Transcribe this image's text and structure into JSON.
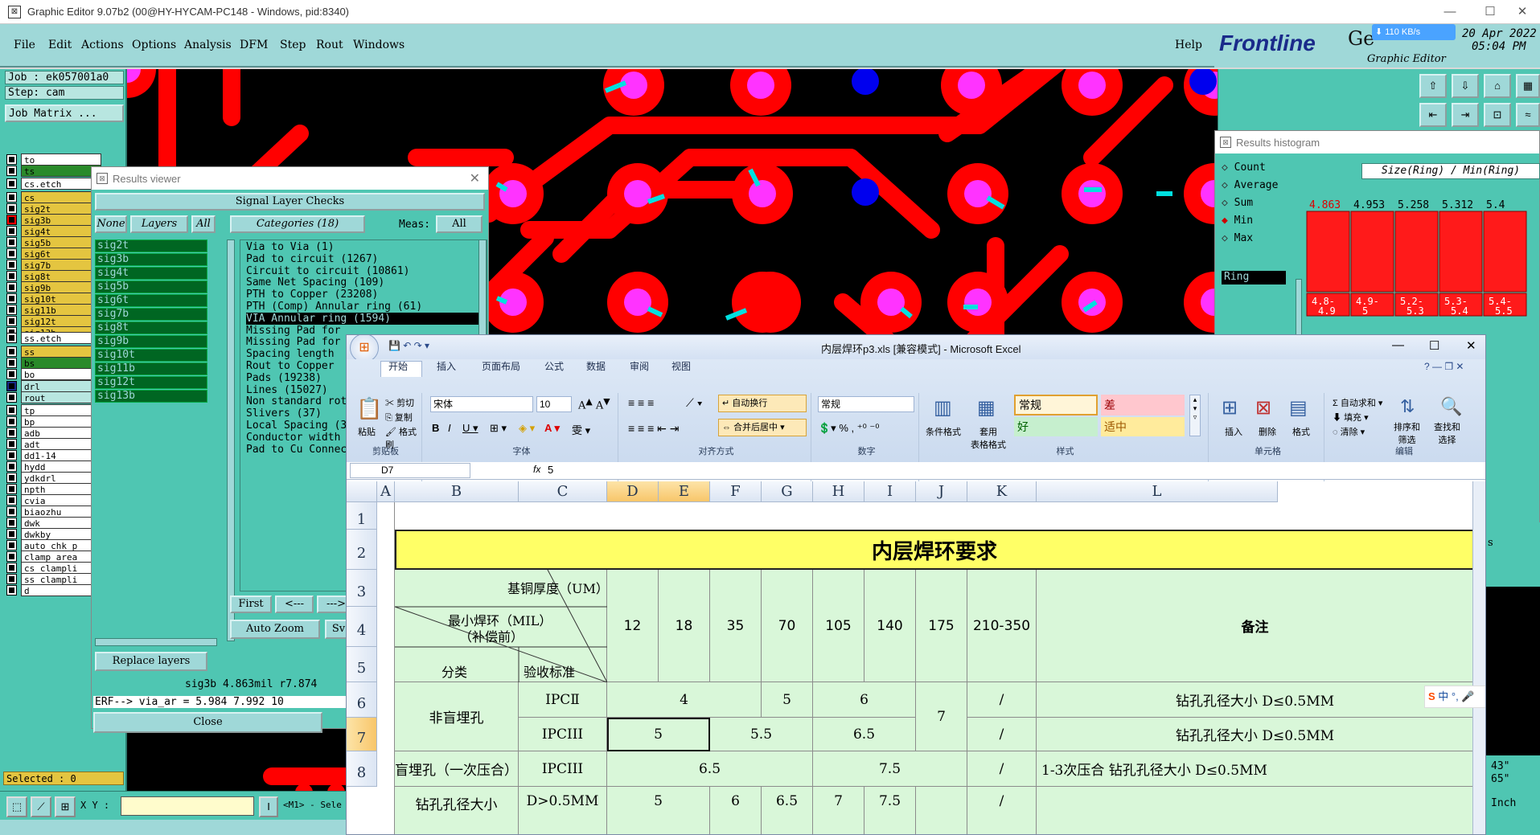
{
  "genesis": {
    "window_title": "Graphic Editor 9.07b2 (00@HY-HYCAM-PC148 - Windows, pid:8340)",
    "menu": [
      "File",
      "Edit",
      "Actions",
      "Options",
      "Analysis",
      "DFM",
      "Step",
      "Rout",
      "Windows"
    ],
    "help": "Help",
    "brand": "Frontline",
    "brand_product": "Ge",
    "brand_sub": "Graphic Editor",
    "date": "20 Apr 2022",
    "time": "05:04 PM",
    "net_speed": "110 KB/s",
    "job_label": "Job : ek057001a0",
    "step_label": "Step: cam",
    "job_matrix": "Job Matrix ...",
    "layers": [
      "to",
      "ts",
      "cs.etch",
      "cs",
      "sig2t",
      "sig3b",
      "sig4t",
      "sig5b",
      "sig6t",
      "sig7b",
      "sig8t",
      "sig9b",
      "sig10t",
      "sig11b",
      "sig12t",
      "sig13b",
      "ss.etch",
      "ss",
      "bs",
      "bo",
      "drl",
      "rout",
      "tp",
      "bp",
      "adb",
      "adt",
      "dd1-14",
      "hydd",
      "ydkdrl",
      "npth",
      "cvia",
      "biaozhu",
      "dwk",
      "dwkby",
      "auto_chk_p",
      "clamp_area",
      "cs_clampli",
      "ss_clampli",
      "d"
    ],
    "selected": "Selected : 0",
    "xy_label": "X Y :",
    "m1_label": "<M1> - Sele"
  },
  "results_viewer": {
    "title": "Results viewer",
    "header": "Signal Layer Checks",
    "btn_none": "None",
    "btn_layers": "Layers",
    "btn_all": "All",
    "categories_label": "Categories (18)",
    "meas_label": "Meas:",
    "meas_value": "All",
    "signal_layers": [
      "sig2t",
      "sig3b",
      "sig4t",
      "sig5b",
      "sig6t",
      "sig7b",
      "sig8t",
      "sig9b",
      "sig10t",
      "sig11b",
      "sig12t",
      "sig13b"
    ],
    "categories": [
      "Via to Via (1)",
      "Pad to circuit (1267)",
      "Circuit to circuit (10861)",
      "Same Net Spacing (109)",
      "PTH to Copper (23208)",
      "PTH (Comp) Annular ring (61)",
      "VIA Annular ring (1594)",
      "Missing Pad for",
      "Missing Pad for",
      "Spacing length",
      "Rout to Copper",
      "Pads (19238)",
      "Lines (15027)",
      "Non standard rot",
      "Slivers (37)",
      "Local Spacing (3",
      "Conductor width",
      "Pad to Cu Connec"
    ],
    "btn_first": "First",
    "btn_prev": "<---",
    "btn_next": "--->",
    "auto_zoom": "Auto Zoom",
    "sv": "Sv",
    "replace_layers": "Replace layers",
    "status1": "sig3b 4.863mil  r7.874",
    "status2": "ERF--> via_ar = 5.984 7.992 10",
    "close": "Close"
  },
  "histogram": {
    "title": "Results histogram",
    "options": [
      "Count",
      "Average",
      "Sum",
      "Min",
      "Max"
    ],
    "selected_option": "Min",
    "field": "Ring",
    "chart_title": "Size(Ring) / Min(Ring)",
    "top_labels": [
      "4.863",
      "4.953",
      "5.258",
      "5.312",
      "5.4"
    ],
    "bottom_labels": [
      "4.8-\n4.9",
      "4.9-\n5",
      "5.2-\n5.3",
      "5.3-\n5.4",
      "5.4-\n5.5"
    ],
    "fragment": "ion",
    "side_frag": "s",
    "frag_43": "43\"",
    "frag_65": "65\"",
    "inch": "Inch"
  },
  "excel": {
    "title": "内层焊环p3.xls  [兼容模式] - Microsoft Excel",
    "tabs": [
      "开始",
      "插入",
      "页面布局",
      "公式",
      "数据",
      "审阅",
      "视图"
    ],
    "groups": {
      "clipboard": "剪贴板",
      "paste": "粘贴",
      "cut": "剪切",
      "copy": "复制",
      "format_painter": "格式刷",
      "font": "字体",
      "font_name": "宋体",
      "font_size": "10",
      "align": "对齐方式",
      "wrap": "自动换行",
      "merge": "合并后居中",
      "number": "数字",
      "number_format": "常规",
      "styles": "样式",
      "cond_format": "条件格式",
      "table_format": "套用\n表格格式",
      "style_normal": "常规",
      "style_bad": "差",
      "style_good": "好",
      "style_neutral": "适中",
      "cells": "单元格",
      "insert": "插入",
      "delete": "删除",
      "format": "格式",
      "edit": "编辑",
      "autosum": "自动求和",
      "fill": "填充",
      "clear": "清除",
      "sort": "排序和\n筛选",
      "find": "查找和\n选择"
    },
    "name_box": "D7",
    "formula": "5",
    "columns": [
      "A",
      "B",
      "C",
      "D",
      "E",
      "F",
      "G",
      "H",
      "I",
      "J",
      "K",
      "L"
    ],
    "rows": [
      "1",
      "2",
      "3",
      "4",
      "5",
      "6",
      "7",
      "8"
    ],
    "sheet": {
      "title": "内层焊环要求",
      "hdr_thickness": "基铜厚度（UM）",
      "hdr_min_ring": "最小焊环（MIL）",
      "hdr_min_ring2": "（补偿前）",
      "hdr_category": "分类",
      "hdr_standard": "验收标准",
      "thickness": [
        "12",
        "18",
        "35",
        "70",
        "105",
        "140",
        "175",
        "210-350"
      ],
      "remark": "备注",
      "r6_cat": "非盲埋孔",
      "r6_std": "IPCⅡ",
      "r6_a": "4",
      "r6_b": "5",
      "r6_c": "6",
      "r67_j": "7",
      "slash": "/",
      "r6_note": "钻孔孔径大小    D≤0.5MM",
      "r7_std": "IPCIII",
      "r7_a": "5",
      "r7_b": "5.5",
      "r7_c": "6.5",
      "r7_note": "钻孔孔径大小    D≤0.5MM",
      "r8_cat": "盲埋孔（一次压合）",
      "r8_std": "IPCIII",
      "r8_a": "6.5",
      "r8_b": "7.5",
      "r8_note": "1-3次压合    钻孔孔径大小    D≤0.5MM",
      "r9_cat": "钻孔孔径大小",
      "r9_a": "D>0.5MM",
      "r9_vals": [
        "5",
        "6",
        "6.5",
        "7",
        "7.5"
      ]
    },
    "ime": "中"
  }
}
